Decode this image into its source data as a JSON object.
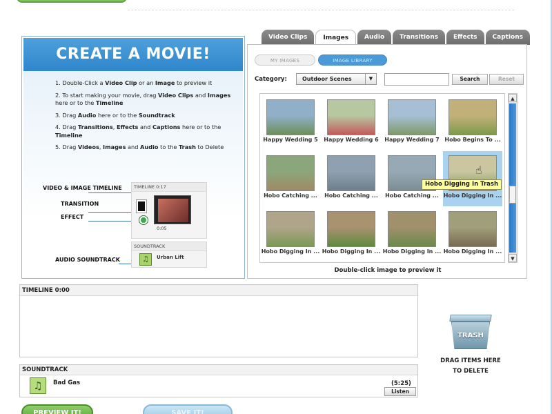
{
  "instructions": {
    "title": "CREATE A MOVIE!",
    "steps": [
      {
        "prefix": "1. Double-Click a ",
        "b1": "Video Clip",
        "mid": " or an ",
        "b2": "Image",
        "suffix": " to preview it"
      },
      {
        "prefix": "2. To start making your movie, drag ",
        "b1": "Video Clips",
        "mid": " and ",
        "b2": "Images",
        "mid2": " here or to the ",
        "b3": "Timeline",
        "suffix": ""
      },
      {
        "prefix": "3. Drag ",
        "b1": "Audio",
        "mid": " here or to the ",
        "b2": "Soundtrack",
        "suffix": ""
      },
      {
        "prefix": "4. Drag ",
        "b1": "Transitions",
        "mid": ", ",
        "b2": "Effects",
        "mid2": " and ",
        "b3": "Captions",
        "suffix": " here or to the ",
        "b4": "Timeline"
      },
      {
        "prefix": "5. Drag ",
        "b1": "Videos",
        "mid": ", ",
        "b2": "Images",
        "mid2": " and ",
        "b3": "Audio",
        "suffix": " to the ",
        "b4": "Trash",
        "suffix2": " to Delete"
      }
    ],
    "diagram": {
      "video_image_timeline": "VIDEO & IMAGE TIMELINE",
      "transition": "TRANSITION",
      "effect": "EFFECT",
      "audio_soundtrack": "AUDIO SOUNDTRACK",
      "mini_timeline_header": "TIMELINE   0:17",
      "mini_clip_time": "0:05",
      "mini_soundtrack_header": "SOUNDTRACK",
      "mini_song": "Urban Lift"
    }
  },
  "tabs": [
    {
      "label": "Video Clips",
      "active": false
    },
    {
      "label": "Images",
      "active": true
    },
    {
      "label": "Audio",
      "active": false
    },
    {
      "label": "Transitions",
      "active": false
    },
    {
      "label": "Effects",
      "active": false
    },
    {
      "label": "Captions",
      "active": false
    }
  ],
  "browser": {
    "my_images": "MY IMAGES",
    "image_library": "IMAGE LIBRARY",
    "category_label": "Category:",
    "category_value": "Outdoor Scenes",
    "search_value": "",
    "search_button": "Search",
    "reset_button": "Reset",
    "hint": "Double-click image to preview it",
    "tooltip": "Hobo Digging In Trash",
    "thumbnails": [
      {
        "caption": "Happy Wedding 5",
        "c1": "#8fb0c8",
        "c2": "#6e8f5a"
      },
      {
        "caption": "Happy Wedding 6",
        "c1": "#b7c7a0",
        "c2": "#c35a5a"
      },
      {
        "caption": "Happy Wedding 7",
        "c1": "#a7bfd4",
        "c2": "#7e9a6a"
      },
      {
        "caption": "Hobo Begins To ...",
        "c1": "#c2b07a",
        "c2": "#7c9b4a"
      },
      {
        "caption": "Hobo Catching ...",
        "c1": "#8aa67a",
        "c2": "#a08a64"
      },
      {
        "caption": "Hobo Catching ...",
        "c1": "#8fa1b0",
        "c2": "#6d7f8a"
      },
      {
        "caption": "Hobo Catching ...",
        "c1": "#97a9b4",
        "c2": "#7c8e94"
      },
      {
        "caption": "Hobo Digging In ...",
        "c1": "#c9c6a0",
        "c2": "#86a05a"
      },
      {
        "caption": "Hobo Digging In ...",
        "c1": "#b0a48a",
        "c2": "#7a9a54"
      },
      {
        "caption": "Hobo Digging In ...",
        "c1": "#a89270",
        "c2": "#5e8a3e"
      },
      {
        "caption": "Hobo Digging In ...",
        "c1": "#a0906c",
        "c2": "#6b8a4a"
      },
      {
        "caption": "Hobo Digging In ...",
        "c1": "#9fa07a",
        "c2": "#7b6a52"
      }
    ]
  },
  "timeline": {
    "label": "TIMELINE   0:00"
  },
  "soundtrack": {
    "label": "SOUNDTRACK",
    "track_name": "Bad Gas",
    "duration": "(5:25)",
    "listen": "Listen"
  },
  "trash": {
    "label": "TRASH",
    "caption_line1": "DRAG ITEMS HERE",
    "caption_line2": "TO DELETE"
  },
  "buttons": {
    "preview": "PREVIEW IT!",
    "save": "SAVE IT!"
  },
  "colors": {
    "accent_blue": "#2f86cb",
    "accent_green": "#5aa53a",
    "tooltip_yellow": "#ffff9c"
  }
}
